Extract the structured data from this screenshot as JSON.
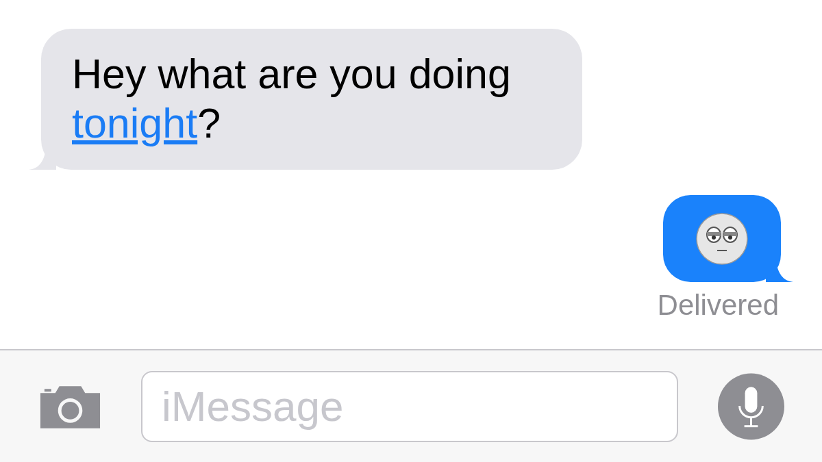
{
  "messages": [
    {
      "kind": "received",
      "text": "Hey what are you doing",
      "link": "tonight",
      "after": "?"
    },
    {
      "kind": "sent",
      "status": "Delivered"
    }
  ],
  "composer": {
    "placeholder": "iMessage"
  }
}
